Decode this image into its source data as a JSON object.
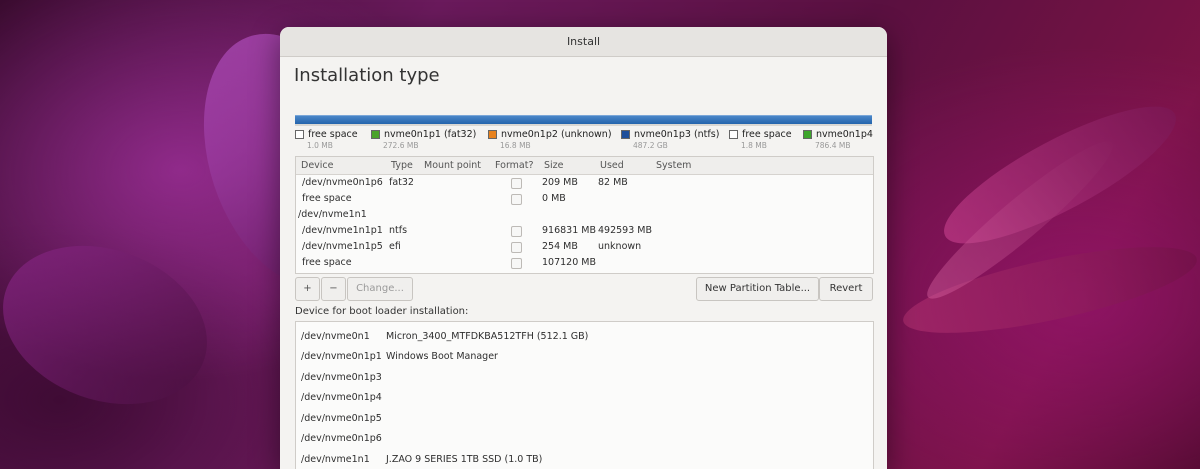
{
  "window": {
    "title": "Install"
  },
  "page_title": "Installation type",
  "partition_bar_legend": [
    {
      "name": "free space",
      "size": "1.0 MB",
      "color": "#ffffff"
    },
    {
      "name": "nvme0n1p1 (fat32)",
      "size": "272.6 MB",
      "color": "#4aa32a"
    },
    {
      "name": "nvme0n1p2 (unknown)",
      "size": "16.8 MB",
      "color": "#e8821e"
    },
    {
      "name": "nvme0n1p3 (ntfs)",
      "size": "487.2 GB",
      "color": "#1f4f9a"
    },
    {
      "name": "free space",
      "size": "1.8 MB",
      "color": "#ffffff"
    },
    {
      "name": "nvme0n1p4",
      "size": "786.4 MB",
      "color": "#3ea52c"
    }
  ],
  "table": {
    "headers": {
      "device": "Device",
      "type": "Type",
      "mount": "Mount point",
      "format": "Format?",
      "size": "Size",
      "used": "Used",
      "system": "System"
    },
    "rows": [
      {
        "device": "/dev/nvme0n1p6",
        "type": "fat32",
        "size": "209 MB",
        "used": "82 MB",
        "checkbox": true
      },
      {
        "device": "free space",
        "type": "",
        "size": "0 MB",
        "used": "",
        "checkbox": true
      },
      {
        "device": "/dev/nvme1n1",
        "type": "",
        "size": "",
        "used": "",
        "checkbox": false
      },
      {
        "device": "/dev/nvme1n1p1",
        "type": "ntfs",
        "size": "916831 MB",
        "used": "492593 MB",
        "checkbox": true
      },
      {
        "device": "/dev/nvme1n1p5",
        "type": "efi",
        "size": "254 MB",
        "used": "unknown",
        "checkbox": true
      },
      {
        "device": "free space",
        "type": "",
        "size": "107120 MB",
        "used": "",
        "checkbox": true
      }
    ]
  },
  "toolbar": {
    "add": "+",
    "remove": "−",
    "change": "Change...",
    "new_partition_table": "New Partition Table...",
    "revert": "Revert"
  },
  "bootloader": {
    "label": "Device for boot loader installation:",
    "items": [
      {
        "device": "/dev/nvme0n1",
        "desc": "Micron_3400_MTFDKBA512TFH (512.1 GB)"
      },
      {
        "device": "/dev/nvme0n1p1",
        "desc": "Windows Boot Manager"
      },
      {
        "device": "/dev/nvme0n1p3",
        "desc": ""
      },
      {
        "device": "/dev/nvme0n1p4",
        "desc": ""
      },
      {
        "device": "/dev/nvme0n1p5",
        "desc": ""
      },
      {
        "device": "/dev/nvme0n1p6",
        "desc": ""
      },
      {
        "device": "/dev/nvme1n1",
        "desc": "J.ZAO 9 SERIES 1TB SSD (1.0 TB)"
      }
    ]
  }
}
